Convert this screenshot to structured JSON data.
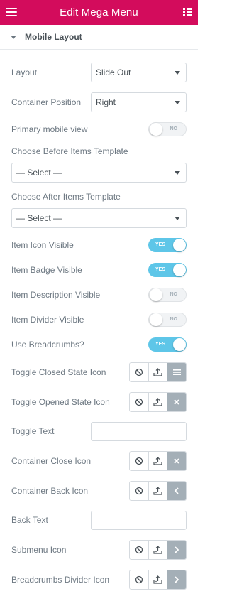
{
  "header": {
    "title": "Edit Mega Menu"
  },
  "section": {
    "title": "Mobile Layout"
  },
  "layout": {
    "label": "Layout",
    "value": "Slide Out"
  },
  "container_position": {
    "label": "Container Position",
    "value": "Right"
  },
  "primary_mobile_view": {
    "label": "Primary mobile view",
    "state": "NO"
  },
  "before_template": {
    "label": "Choose Before Items Template",
    "value": "— Select —"
  },
  "after_template": {
    "label": "Choose After Items Template",
    "value": "— Select —"
  },
  "item_icon_visible": {
    "label": "Item Icon Visible",
    "state": "YES"
  },
  "item_badge_visible": {
    "label": "Item Badge Visible",
    "state": "YES"
  },
  "item_description_visible": {
    "label": "Item Description Visible",
    "state": "NO"
  },
  "item_divider_visible": {
    "label": "Item Divider Visible",
    "state": "NO"
  },
  "use_breadcrumbs": {
    "label": "Use Breadcrumbs?",
    "state": "YES"
  },
  "toggle_closed_icon": {
    "label": "Toggle Closed State Icon",
    "icon": "bars-icon"
  },
  "toggle_opened_icon": {
    "label": "Toggle Opened State Icon",
    "icon": "times-icon"
  },
  "toggle_text": {
    "label": "Toggle Text",
    "value": ""
  },
  "container_close_icon": {
    "label": "Container Close Icon",
    "icon": "times-icon"
  },
  "container_back_icon": {
    "label": "Container Back Icon",
    "icon": "angle-left-icon"
  },
  "back_text": {
    "label": "Back Text",
    "value": ""
  },
  "submenu_icon": {
    "label": "Submenu Icon",
    "icon": "angle-right-icon"
  },
  "breadcrumbs_divider_icon": {
    "label": "Breadcrumbs Divider Icon",
    "icon": "angle-right-icon"
  },
  "colors": {
    "header": "#d30c5c",
    "toggle_on": "#5ec6e8",
    "active_icon": "#a4afb7"
  }
}
